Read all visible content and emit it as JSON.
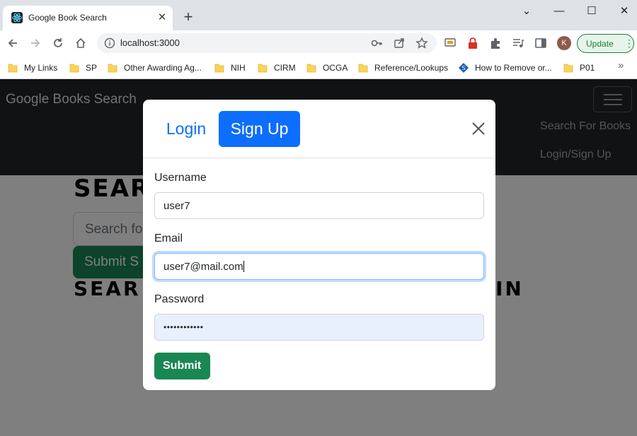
{
  "browser": {
    "tab_title": "Google Book Search",
    "tab_close": "✕",
    "new_tab": "+",
    "window_controls": {
      "minimize": "—",
      "maximize": "☐",
      "close": "✕",
      "tab_search": "⌄"
    },
    "url": "localhost:3000",
    "profile_initial": "K",
    "update_label": "Update",
    "update_menu": "⋮",
    "bookmarks": [
      {
        "label": "My Links",
        "icon": "folder-icon"
      },
      {
        "label": "SP",
        "icon": "folder-icon"
      },
      {
        "label": "Other Awarding Ag...",
        "icon": "folder-icon"
      },
      {
        "label": "NIH",
        "icon": "folder-icon"
      },
      {
        "label": "CIRM",
        "icon": "folder-icon"
      },
      {
        "label": "OCGA",
        "icon": "folder-icon"
      },
      {
        "label": "Reference/Lookups",
        "icon": "folder-icon"
      },
      {
        "label": "How to Remove or...",
        "icon": "site-icon"
      },
      {
        "label": "P01",
        "icon": "folder-icon"
      }
    ],
    "bookmarks_more": "»"
  },
  "app": {
    "brand": "Google Books Search",
    "nav_links": [
      "Search For Books",
      "Login/Sign Up"
    ],
    "hero_title": "SEAR",
    "search_placeholder": "Search fo",
    "search_submit": "Submit S",
    "results_heading": "SEAR",
    "results_tail": "IN"
  },
  "modal": {
    "tabs": {
      "login": "Login",
      "signup": "Sign Up",
      "active": "signup"
    },
    "fields": {
      "username": {
        "label": "Username",
        "value": "user7"
      },
      "email": {
        "label": "Email",
        "value": "user7@mail.com"
      },
      "password": {
        "label": "Password",
        "value": "••••••••••••"
      }
    },
    "submit": "Submit"
  },
  "colors": {
    "primary": "#0d6efd",
    "success": "#198754",
    "navbar": "#212529",
    "update_green": "#188038"
  }
}
